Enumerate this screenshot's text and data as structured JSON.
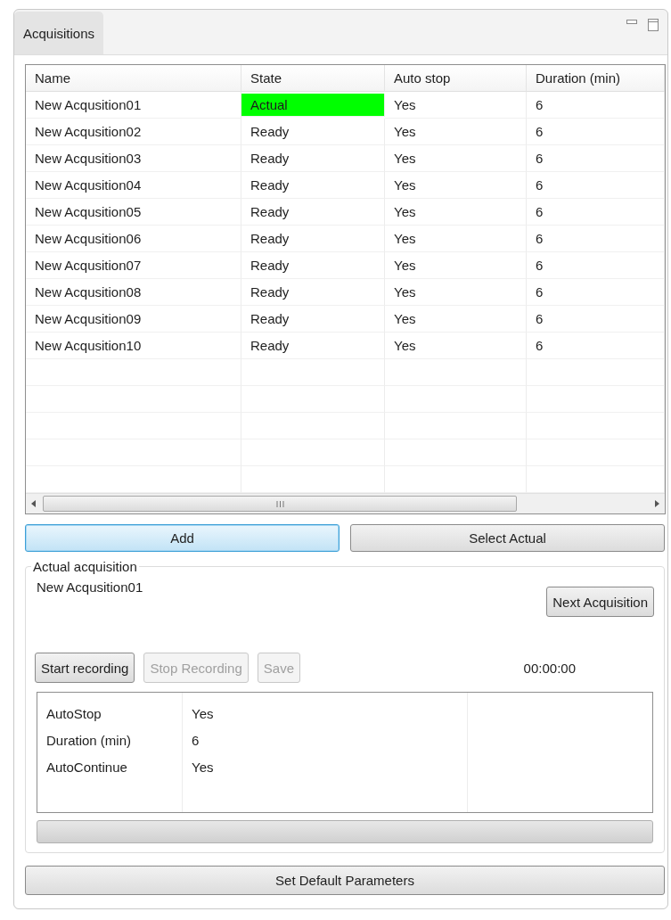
{
  "panel": {
    "tab": {
      "label": "Acquisitions",
      "selected": true
    }
  },
  "table": {
    "columns": [
      "Name",
      "State",
      "Auto stop",
      "Duration (min)"
    ],
    "rows": [
      {
        "name": "New Acqusition01",
        "state": "Actual",
        "highlighted": true,
        "auto_stop": "Yes",
        "duration": "6"
      },
      {
        "name": "New Acqusition02",
        "state": "Ready",
        "highlighted": false,
        "auto_stop": "Yes",
        "duration": "6"
      },
      {
        "name": "New Acqusition03",
        "state": "Ready",
        "highlighted": false,
        "auto_stop": "Yes",
        "duration": "6"
      },
      {
        "name": "New Acqusition04",
        "state": "Ready",
        "highlighted": false,
        "auto_stop": "Yes",
        "duration": "6"
      },
      {
        "name": "New Acqusition05",
        "state": "Ready",
        "highlighted": false,
        "auto_stop": "Yes",
        "duration": "6"
      },
      {
        "name": "New Acqusition06",
        "state": "Ready",
        "highlighted": false,
        "auto_stop": "Yes",
        "duration": "6"
      },
      {
        "name": "New Acqusition07",
        "state": "Ready",
        "highlighted": false,
        "auto_stop": "Yes",
        "duration": "6"
      },
      {
        "name": "New Acqusition08",
        "state": "Ready",
        "highlighted": false,
        "auto_stop": "Yes",
        "duration": "6"
      },
      {
        "name": "New Acqusition09",
        "state": "Ready",
        "highlighted": false,
        "auto_stop": "Yes",
        "duration": "6"
      },
      {
        "name": "New Acqusition10",
        "state": "Ready",
        "highlighted": false,
        "auto_stop": "Yes",
        "duration": "6"
      }
    ]
  },
  "actions": [
    {
      "label": "Add",
      "focused": true
    },
    {
      "label": "Select Actual",
      "focused": false
    }
  ],
  "actual_acquisition": {
    "title": "Actual acquisition",
    "name": "New Acqusition01",
    "next_button": "Next Acquisition",
    "controls": [
      {
        "label": "Start recording",
        "disabled": false
      },
      {
        "label": "Stop Recording",
        "disabled": true
      },
      {
        "label": "Save",
        "disabled": true
      }
    ],
    "timer": "00:00:00",
    "properties": [
      {
        "name": "AutoStop",
        "value": "Yes"
      },
      {
        "name": "Duration (min)",
        "value": "6"
      },
      {
        "name": "AutoContinue",
        "value": "Yes"
      }
    ],
    "progress": {
      "level": 0
    }
  },
  "default_button": "Set Default Parameters"
}
